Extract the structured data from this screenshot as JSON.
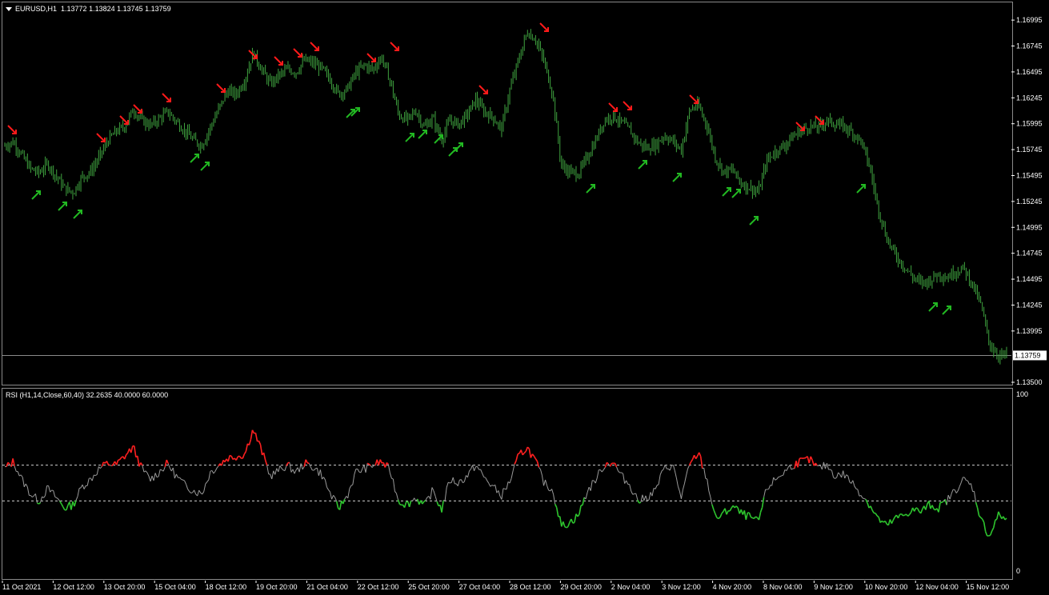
{
  "main": {
    "symbol_label": "EURUSD,H1",
    "ohlc_label": "1.13772 1.13824 1.13745 1.13759",
    "current_price_label": "1.13759"
  },
  "rsi": {
    "header_label": "RSI (H1,14,Close,60,40) 32.2635 40.0000 60.0000"
  },
  "colors": {
    "background": "#000000",
    "bars": "#3fa33f",
    "arrow_up": "#22b822",
    "arrow_down": "#ff1a1a",
    "rsi_neutral": "#9a9a9a",
    "rsi_overbought": "#ff2020",
    "rsi_oversold": "#2ec42e",
    "border": "#8a8a8a"
  },
  "chart_data": [
    {
      "type": "line",
      "title": "EURUSD,H1",
      "y_ticks": [
        "1.16995",
        "1.16745",
        "1.16495",
        "1.16245",
        "1.15995",
        "1.15745",
        "1.15495",
        "1.15245",
        "1.14995",
        "1.14745",
        "1.14495",
        "1.14245",
        "1.13995",
        "1.13500"
      ],
      "ylim": [
        1.135,
        1.1705
      ],
      "current_price": 1.13759,
      "x_ticks": [
        "11 Oct 2021",
        "12 Oct 12:00",
        "13 Oct 20:00",
        "15 Oct 04:00",
        "18 Oct 12:00",
        "19 Oct 20:00",
        "21 Oct 04:00",
        "22 Oct 12:00",
        "25 Oct 20:00",
        "27 Oct 04:00",
        "28 Oct 12:00",
        "29 Oct 20:00",
        "2 Nov 04:00",
        "3 Nov 12:00",
        "4 Nov 20:00",
        "8 Nov 04:00",
        "9 Nov 12:00",
        "10 Nov 20:00",
        "12 Nov 04:00",
        "15 Nov 12:00"
      ],
      "series": [
        {
          "values": [
            1.1578,
            1.1582,
            1.1569,
            1.1556,
            1.1552,
            1.1561,
            1.1549,
            1.1537,
            1.1533,
            1.1548,
            1.1553,
            1.1567,
            1.1583,
            1.1592,
            1.1597,
            1.1613,
            1.1603,
            1.1598,
            1.1604,
            1.1611,
            1.1602,
            1.1593,
            1.1584,
            1.1578,
            1.1596,
            1.1614,
            1.1631,
            1.1628,
            1.1641,
            1.1668,
            1.1652,
            1.1638,
            1.1646,
            1.1652,
            1.1649,
            1.1661,
            1.1658,
            1.1653,
            1.1642,
            1.1628,
            1.1633,
            1.1649,
            1.1656,
            1.1652,
            1.1664,
            1.1641,
            1.1608,
            1.1603,
            1.1612,
            1.1596,
            1.1605,
            1.1584,
            1.1603,
            1.1599,
            1.1608,
            1.1623,
            1.1611,
            1.1606,
            1.1594,
            1.1633,
            1.1661,
            1.1688,
            1.1681,
            1.1659,
            1.1628,
            1.1559,
            1.1553,
            1.1551,
            1.1567,
            1.1583,
            1.1603,
            1.1607,
            1.1601,
            1.1593,
            1.1581,
            1.1576,
            1.1579,
            1.1588,
            1.1583,
            1.1574,
            1.1613,
            1.1617,
            1.1598,
            1.1566,
            1.1553,
            1.1555,
            1.1542,
            1.1538,
            1.1533,
            1.1564,
            1.1573,
            1.1578,
            1.1587,
            1.1593,
            1.1597,
            1.1596,
            1.1603,
            1.1599,
            1.1597,
            1.1591,
            1.1583,
            1.1558,
            1.1518,
            1.1489,
            1.1473,
            1.1462,
            1.1452,
            1.1446,
            1.1448,
            1.1455,
            1.1451,
            1.1457,
            1.146,
            1.1445,
            1.1425,
            1.1387,
            1.1376,
            1.1376
          ]
        }
      ]
    },
    {
      "type": "line",
      "title": "RSI (H1,14,Close,60,40) 32.2635 40.0000 60.0000",
      "y_ticks": [
        "100",
        "0"
      ],
      "ylim": [
        0,
        100
      ],
      "levels": [
        40,
        60
      ],
      "series": [
        {
          "values": [
            58,
            62,
            52,
            44,
            40,
            47,
            42,
            36,
            38,
            48,
            52,
            58,
            61,
            60,
            65,
            70,
            58,
            52,
            56,
            61,
            54,
            49,
            46,
            44,
            56,
            60,
            64,
            65,
            66,
            80,
            68,
            54,
            57,
            60,
            56,
            61,
            59,
            55,
            44,
            36,
            43,
            56,
            58,
            60,
            62,
            57,
            40,
            38,
            42,
            37,
            46,
            35,
            52,
            50,
            54,
            60,
            53,
            48,
            43,
            51,
            65,
            70,
            62,
            50,
            46,
            26,
            28,
            32,
            45,
            52,
            60,
            62,
            54,
            49,
            40,
            42,
            46,
            58,
            60,
            42,
            60,
            67,
            52,
            30,
            33,
            37,
            33,
            31,
            28,
            47,
            52,
            56,
            60,
            62,
            63,
            58,
            60,
            54,
            55,
            50,
            44,
            38,
            30,
            26,
            30,
            32,
            35,
            34,
            38,
            36,
            40,
            46,
            52,
            48,
            30,
            20,
            32,
            30
          ]
        }
      ]
    }
  ]
}
